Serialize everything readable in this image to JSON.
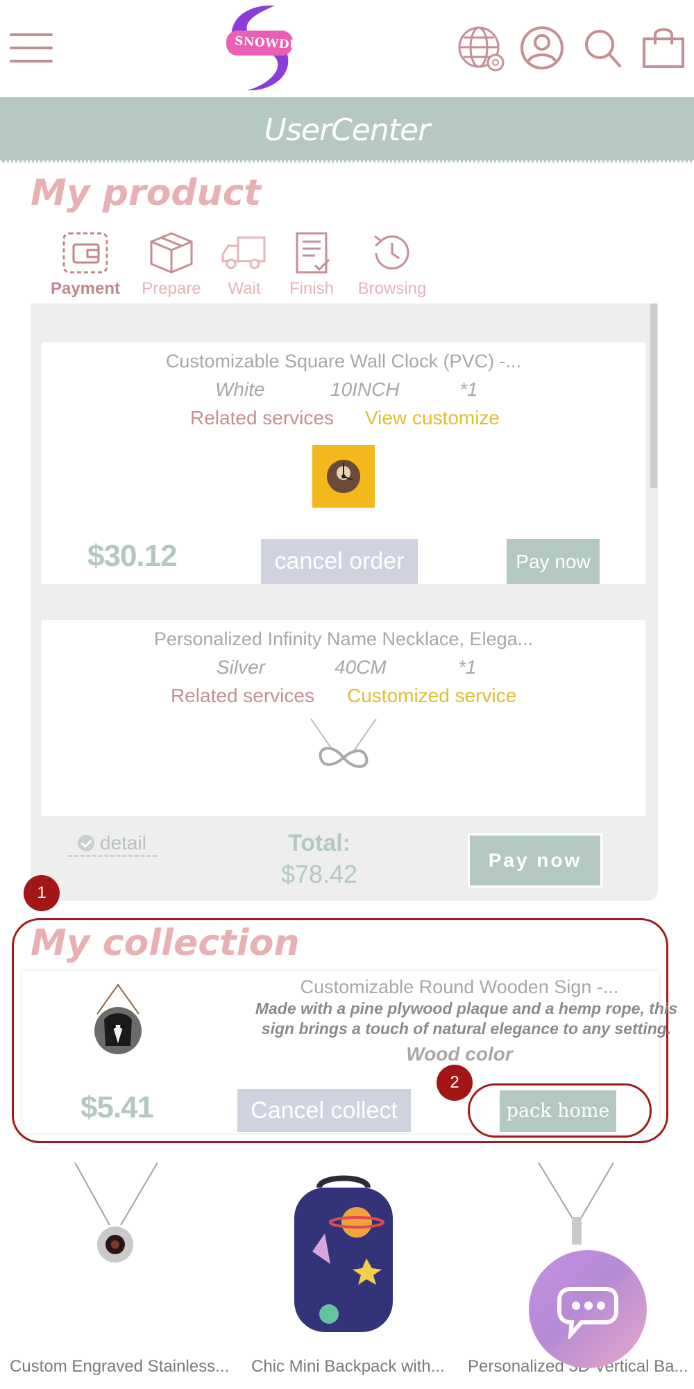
{
  "header": {
    "logo_text": "SNOWDUN",
    "icons": [
      "menu-icon",
      "globe-settings-icon",
      "user-icon",
      "search-icon",
      "shopping-bag-icon"
    ]
  },
  "usercenter": {
    "title": "UserCenter"
  },
  "my_product": {
    "title": "My product",
    "tabs": [
      {
        "label": "Payment",
        "icon": "wallet-icon",
        "active": true
      },
      {
        "label": "Prepare",
        "icon": "box-icon",
        "active": false
      },
      {
        "label": "Wait",
        "icon": "truck-icon",
        "active": false
      },
      {
        "label": "Finish",
        "icon": "document-check-icon",
        "active": false
      },
      {
        "label": "Browsing",
        "icon": "history-icon",
        "active": false
      }
    ],
    "orders": [
      {
        "title": "Customizable Square Wall Clock (PVC) -...",
        "color": "White",
        "size": "10INCH",
        "qty": "*1",
        "related": "Related services",
        "custom": "View customize",
        "price": "$30.12",
        "cancel": "cancel order",
        "pay": "Pay now"
      },
      {
        "title": "Personalized Infinity Name Necklace, Elega...",
        "color": "Silver",
        "size": "40CM",
        "qty": "*1",
        "related": "Related services",
        "custom": "Customized service"
      }
    ],
    "detail": "detail",
    "total_label": "Total:",
    "total_value": "$78.42",
    "pay_all": "Pay now"
  },
  "badges": {
    "one": "1",
    "two": "2"
  },
  "my_collection": {
    "title": "My collection",
    "item": {
      "title": "Customizable Round Wooden Sign -...",
      "desc_line1": "Made with a pine plywood plaque and a hemp rope, this",
      "desc_line2": "sign brings a touch of natural elegance to any setting.",
      "color": "Wood color",
      "price": "$5.41",
      "cancel": "Cancel collect",
      "pack": "pack home"
    }
  },
  "recommended": [
    {
      "name": "Custom Engraved Stainless..."
    },
    {
      "name": "Chic Mini Backpack with..."
    },
    {
      "name": "Personalized 3D Vertical Ba..."
    }
  ],
  "colors": {
    "accent_pink": "#e8b0b3",
    "muted_teal": "#b3c7c3",
    "gold": "#e3bd2d",
    "badge_red": "#a31616"
  }
}
